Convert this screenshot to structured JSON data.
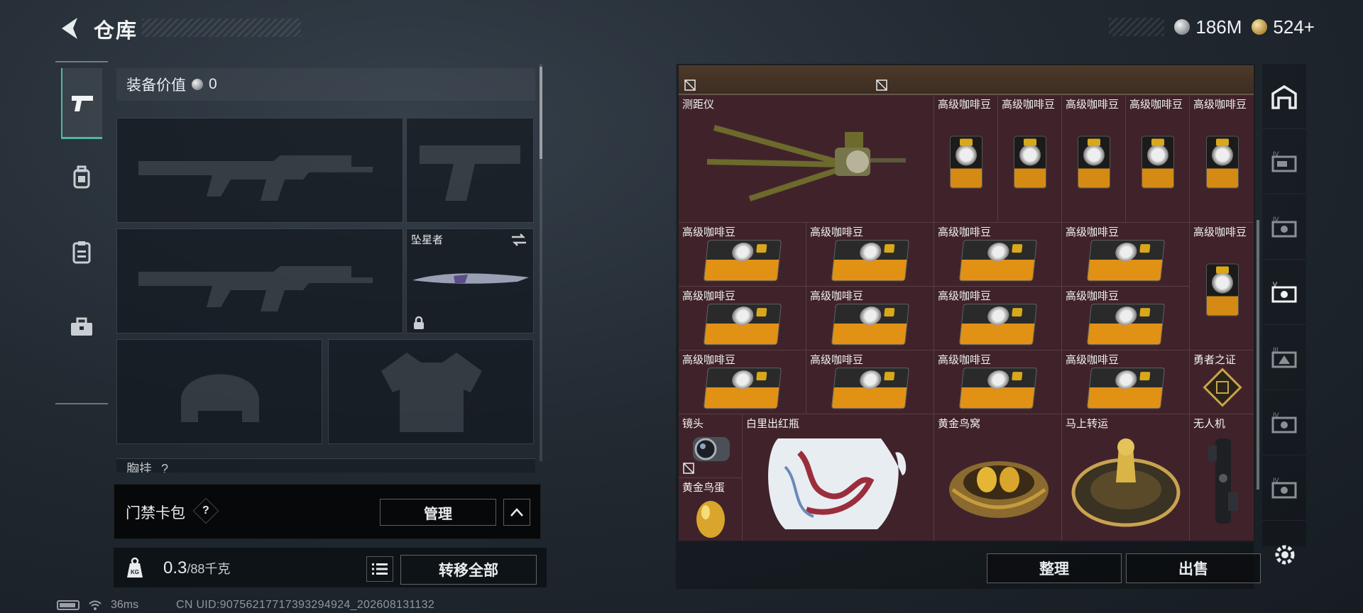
{
  "header": {
    "title": "仓库",
    "silver_amount": "186M",
    "gold_amount": "524+"
  },
  "equipment": {
    "value_label": "装备价值",
    "value": "0",
    "melee_name": "坠星者",
    "chest_label": "胸挂",
    "chest_hint": "?"
  },
  "keycard": {
    "label": "门禁卡包",
    "help": "?",
    "manage_label": "管理"
  },
  "backpack": {
    "weight_value": "0.3",
    "weight_max": "/88千克",
    "transfer_label": "转移全部",
    "weight_icon_text": "KG"
  },
  "status": {
    "ping": "36ms",
    "uid": "CN UID:90756217717393294924_202608131132"
  },
  "storage": {
    "items": {
      "rangefinder": "测距仪",
      "coffee": "高级咖啡豆",
      "hero_cert": "勇者之证",
      "lens": "镜头",
      "vase": "白里出红瓶",
      "golden_nest": "黄金鸟窝",
      "fortune": "马上转运",
      "drone": "无人机",
      "golden_egg": "黄金鸟蛋"
    },
    "sort_label": "整理",
    "sell_label": "出售"
  },
  "colors": {
    "accent": "#4fb7a0",
    "cell_bg": "#40232a",
    "coffee_orange": "#e19215"
  }
}
